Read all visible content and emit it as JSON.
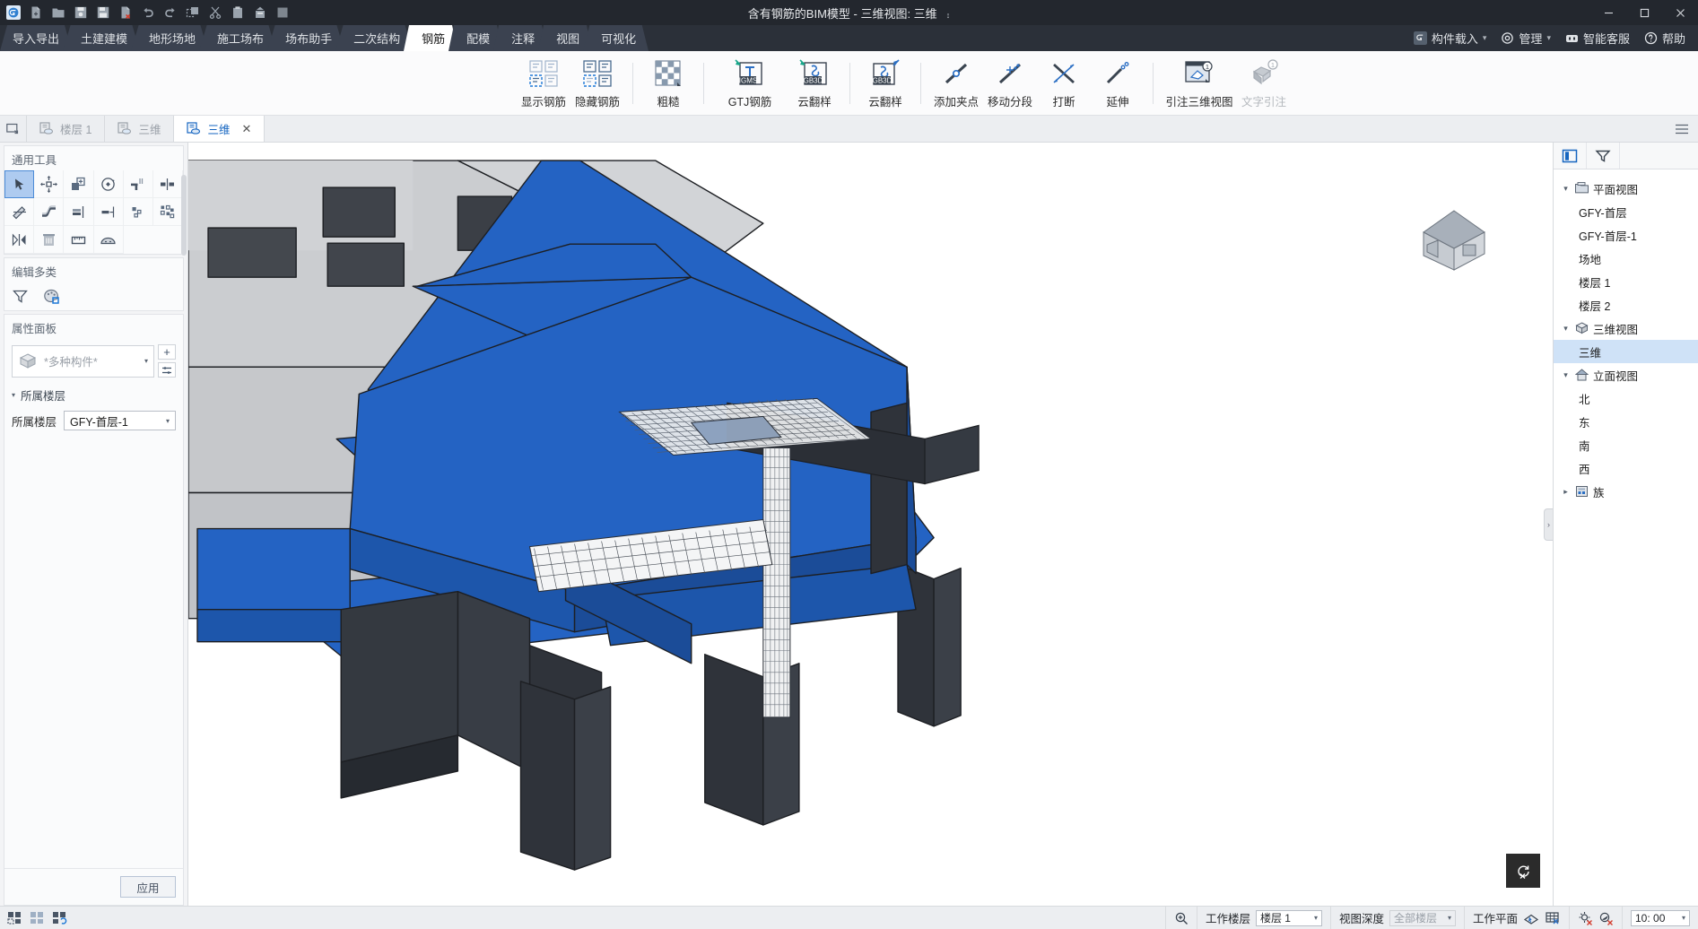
{
  "titlebar": {
    "title": "含有钢筋的BIM模型 - 三维视图: 三维",
    "quick_access": [
      {
        "name": "app-logo-icon",
        "label": "GJ"
      },
      {
        "name": "new-file-icon",
        "label": "新建"
      },
      {
        "name": "open-folder-icon",
        "label": "打开"
      },
      {
        "name": "save-icon",
        "label": "保存"
      },
      {
        "name": "save-as-icon",
        "label": "另存为"
      },
      {
        "name": "close-file-icon",
        "label": "关闭"
      },
      {
        "name": "undo-icon",
        "label": "撤销"
      },
      {
        "name": "redo-icon",
        "label": "恢复"
      },
      {
        "name": "copy-icon",
        "label": "复制"
      },
      {
        "name": "cut-icon",
        "label": "剪切"
      },
      {
        "name": "paste-icon",
        "label": "粘贴"
      },
      {
        "name": "match-icon",
        "label": "格式刷"
      },
      {
        "name": "cube-icon",
        "label": "三维"
      }
    ],
    "window_buttons": {
      "minimize": "–",
      "maximize": "❐",
      "close": "✕"
    }
  },
  "menubar": {
    "tabs": [
      {
        "label": "导入导出",
        "active": false
      },
      {
        "label": "土建建模",
        "active": false
      },
      {
        "label": "地形场地",
        "active": false
      },
      {
        "label": "施工场布",
        "active": false
      },
      {
        "label": "场布助手",
        "active": false
      },
      {
        "label": "二次结构",
        "active": false
      },
      {
        "label": "钢筋",
        "active": true
      },
      {
        "label": "配模",
        "active": false
      },
      {
        "label": "注释",
        "active": false
      },
      {
        "label": "视图",
        "active": false
      },
      {
        "label": "可视化",
        "active": false
      }
    ],
    "right_items": [
      {
        "label": "构件载入",
        "icon": "component-load-icon",
        "caret": true
      },
      {
        "label": "管理",
        "icon": "gear-icon",
        "caret": true
      },
      {
        "label": "智能客服",
        "icon": "support-icon",
        "caret": false
      },
      {
        "label": "帮助",
        "icon": "help-bulb-icon",
        "caret": false
      }
    ]
  },
  "ribbon": {
    "groups": [
      {
        "items": [
          {
            "label": "显示钢筋",
            "icon": "show-rebar-icon",
            "disabled": false
          },
          {
            "label": "隐藏钢筋",
            "icon": "hide-rebar-icon",
            "disabled": false
          }
        ]
      },
      {
        "items": [
          {
            "label": "粗糙",
            "icon": "checker-rough-icon",
            "disabled": false
          }
        ]
      },
      {
        "items": [
          {
            "label": "GTJ钢筋",
            "icon": "igms-import-icon",
            "disabled": false
          },
          {
            "label": "云翻样",
            "icon": "gb3d-import-icon",
            "disabled": false
          }
        ]
      },
      {
        "items": [
          {
            "label": "云翻样",
            "icon": "gb3d-export-icon",
            "disabled": false
          }
        ]
      },
      {
        "items": [
          {
            "label": "添加夹点",
            "icon": "add-grip-icon",
            "disabled": false
          },
          {
            "label": "移动分段",
            "icon": "move-segment-icon",
            "disabled": false
          },
          {
            "label": "打断",
            "icon": "break-icon",
            "disabled": false
          },
          {
            "label": "延伸",
            "icon": "extend-icon",
            "disabled": false
          }
        ]
      },
      {
        "items": [
          {
            "label": "引注三维视图",
            "icon": "annotate-3d-view-icon",
            "disabled": false
          },
          {
            "label": "文字引注",
            "icon": "text-leader-icon",
            "disabled": true
          }
        ]
      }
    ]
  },
  "doc_tabs": {
    "restore_icon": "restore-window-icon",
    "tabs": [
      {
        "label": "楼层 1",
        "active": false,
        "closable": false
      },
      {
        "label": "三维",
        "active": false,
        "closable": false
      },
      {
        "label": "三维",
        "active": true,
        "closable": true
      }
    ],
    "menu_icon": "hamburger-icon"
  },
  "left_panel": {
    "common_tools": {
      "title": "通用工具",
      "row1": [
        {
          "name": "select-tool",
          "selected": true
        },
        {
          "name": "move-tool",
          "selected": false
        },
        {
          "name": "copy-tool",
          "selected": false
        },
        {
          "name": "rotate-tool",
          "selected": false
        },
        {
          "name": "trim-tool",
          "selected": false
        },
        {
          "name": "mirror-tool",
          "selected": false
        }
      ],
      "row2": [
        {
          "name": "offset-tool",
          "selected": false
        },
        {
          "name": "fillet-tool",
          "selected": false
        },
        {
          "name": "align-tool",
          "selected": false
        },
        {
          "name": "extend-tool",
          "selected": false
        },
        {
          "name": "scatter-tool",
          "selected": false
        },
        {
          "name": "array-tool",
          "selected": false
        }
      ],
      "row3": [
        {
          "name": "flip-tool",
          "selected": false
        },
        {
          "name": "delete-tool",
          "selected": false
        },
        {
          "name": "measure-tool",
          "selected": false
        },
        {
          "name": "section-tool",
          "selected": false
        }
      ]
    },
    "edit_multi": {
      "title": "编辑多类",
      "tools": [
        {
          "name": "filter-icon"
        },
        {
          "name": "palette-icon"
        }
      ]
    },
    "properties": {
      "title": "属性面板",
      "type_value": "*多种构件*",
      "add_button": "+",
      "edit_button": "≡",
      "section_label": "所属楼层",
      "field_label": "所属楼层",
      "field_value": "GFY-首层-1",
      "apply_label": "应用"
    }
  },
  "viewport": {
    "view_cube_name": "house-view-cube",
    "reset_button_name": "reset-view-button",
    "collapse_handle": "›",
    "model_blue": "#2463c3",
    "model_dark": "#2f333a",
    "model_gray": "#c9cbcd"
  },
  "right_panel": {
    "tabs": [
      {
        "name": "project-browser-tab",
        "active": true
      },
      {
        "name": "filter-tab",
        "active": false
      }
    ],
    "tree": [
      {
        "label": "平面视图",
        "level": 0,
        "icon": "plan-views-folder-icon",
        "expanded": true,
        "selected": false
      },
      {
        "label": "GFY-首层",
        "level": 1,
        "selected": false
      },
      {
        "label": "GFY-首层-1",
        "level": 1,
        "selected": false
      },
      {
        "label": "场地",
        "level": 1,
        "selected": false
      },
      {
        "label": "楼层 1",
        "level": 1,
        "selected": false
      },
      {
        "label": "楼层 2",
        "level": 1,
        "selected": false
      },
      {
        "label": "三维视图",
        "level": 0,
        "icon": "3d-views-icon",
        "expanded": true,
        "selected": false
      },
      {
        "label": "三维",
        "level": 1,
        "selected": true
      },
      {
        "label": "立面视图",
        "level": 0,
        "icon": "elevation-views-icon",
        "expanded": true,
        "selected": false
      },
      {
        "label": "北",
        "level": 1,
        "selected": false
      },
      {
        "label": "东",
        "level": 1,
        "selected": false
      },
      {
        "label": "南",
        "level": 1,
        "selected": false
      },
      {
        "label": "西",
        "level": 1,
        "selected": false
      },
      {
        "label": "族",
        "level": 0,
        "icon": "families-icon",
        "expanded": false,
        "selected": false
      }
    ]
  },
  "statusbar": {
    "left_icons": [
      {
        "name": "select-mode-icon"
      },
      {
        "name": "crop-region-icon"
      },
      {
        "name": "revert-icon"
      }
    ],
    "zoom_icon": "zoom-region-icon",
    "work_level_label": "工作楼层",
    "work_level_value": "楼层 1",
    "view_depth_label": "视图深度",
    "view_depth_value": "全部楼层",
    "work_plane_label": "工作平面",
    "work_plane_icons": [
      {
        "name": "work-plane-pick-icon"
      },
      {
        "name": "work-plane-grid-icon"
      }
    ],
    "right_icons": [
      {
        "name": "sun-off-icon"
      },
      {
        "name": "shadow-off-icon"
      }
    ],
    "time_value": "10: 00"
  }
}
